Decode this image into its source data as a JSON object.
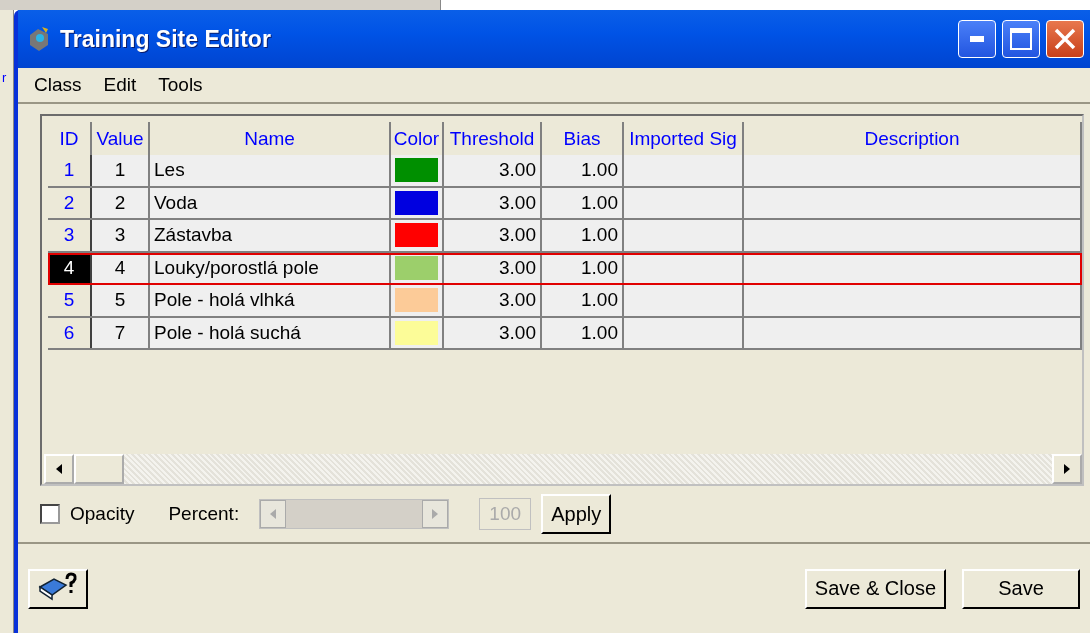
{
  "background_window": {
    "fragment": "r"
  },
  "window": {
    "title": "Training Site Editor"
  },
  "menu": [
    "Class",
    "Edit",
    "Tools"
  ],
  "table": {
    "columns": [
      "ID",
      "Value",
      "Name",
      "Color",
      "Threshold",
      "Bias",
      "Imported Sig",
      "Description"
    ],
    "rows": [
      {
        "id": "1",
        "value": "1",
        "name": "Les",
        "color": "#008f00",
        "threshold": "3.00",
        "bias": "1.00",
        "selected": false
      },
      {
        "id": "2",
        "value": "2",
        "name": "Voda",
        "color": "#0000e0",
        "threshold": "3.00",
        "bias": "1.00",
        "selected": false
      },
      {
        "id": "3",
        "value": "3",
        "name": "Zástavba",
        "color": "#ff0000",
        "threshold": "3.00",
        "bias": "1.00",
        "selected": false
      },
      {
        "id": "4",
        "value": "4",
        "name": "Louky/porostlá pole",
        "color": "#9ccf6b",
        "threshold": "3.00",
        "bias": "1.00",
        "selected": true
      },
      {
        "id": "5",
        "value": "5",
        "name": "Pole - holá vlhká",
        "color": "#fccb98",
        "threshold": "3.00",
        "bias": "1.00",
        "selected": false
      },
      {
        "id": "6",
        "value": "7",
        "name": "Pole - holá suchá",
        "color": "#fcfc98",
        "threshold": "3.00",
        "bias": "1.00",
        "selected": false
      }
    ]
  },
  "opacity": {
    "label": "Opacity",
    "checked": false,
    "percent_label": "Percent:",
    "level": 1,
    "value": "100",
    "apply": "Apply",
    "disabled": true
  },
  "buttons": [
    "Save & Close",
    "Save"
  ]
}
